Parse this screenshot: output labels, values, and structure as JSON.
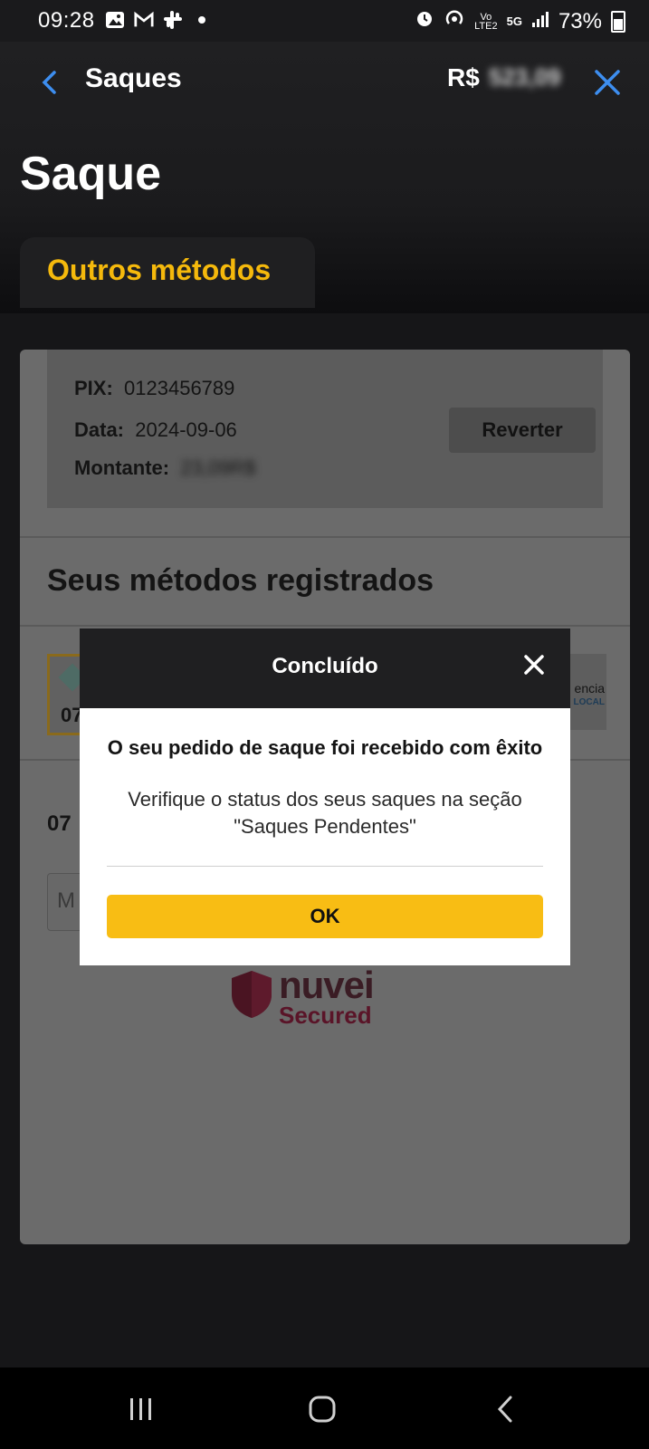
{
  "status_bar": {
    "time": "09:28",
    "network_top": "Vo",
    "network_bottom": "LTE2",
    "fiveg": "5G",
    "battery": "73%",
    "icons": [
      "image-icon",
      "gmail-icon",
      "slack-icon",
      "dot-icon",
      "alarm-icon",
      "hotspot-icon",
      "signal-icon",
      "battery-icon"
    ]
  },
  "header": {
    "title": "Saques",
    "balance_label": "R$",
    "balance_value": "523,09",
    "page_title": "Saque",
    "tab_label": "Outros métodos"
  },
  "pending": {
    "pix_label": "PIX:",
    "pix_value": "0123456789",
    "date_label": "Data:",
    "date_value": "2024-09-06",
    "amount_label": "Montante:",
    "amount_value": "23,09R$",
    "revert_label": "Reverter"
  },
  "methods": {
    "title": "Seus métodos registrados",
    "card_number_partial": "07",
    "card_right_text1": "encia",
    "card_right_text2": "LOCAL",
    "row_partial": "07",
    "input_partial": "M"
  },
  "security": {
    "brand": "nuvei",
    "secured": "Secured"
  },
  "modal": {
    "title": "Concluído",
    "message_bold": "O seu pedido de saque foi recebido com êxito",
    "message": "Verifique o status dos seus saques na seção \"Saques Pendentes\"",
    "ok_label": "OK"
  },
  "colors": {
    "accent": "#f5b90c",
    "button": "#f8bd14",
    "link_blue": "#3d8ef0",
    "modal_header": "#1f1f21"
  }
}
